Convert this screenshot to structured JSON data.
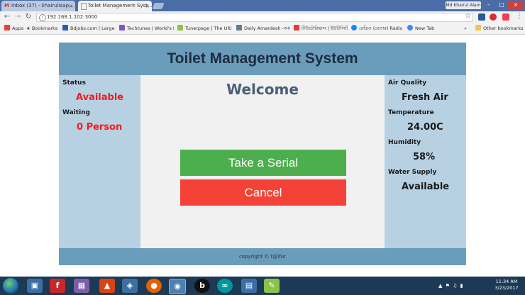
{
  "browser": {
    "tabs": [
      {
        "label": "Inbox (37) - khairulisap…",
        "active": false,
        "favicon": "M"
      },
      {
        "label": "Toilet Management Syst…",
        "active": true,
        "favicon": ""
      }
    ],
    "tab_close": "×",
    "user_label": "Md Khairul Alam",
    "window_buttons": {
      "minimize": "–",
      "maximize": "□",
      "close": "×"
    },
    "url": "192.168.1.102:3000",
    "bookmarks": [
      {
        "label": "Apps",
        "color": "#e94235"
      },
      {
        "label": "Bookmarks",
        "color": "#555555"
      },
      {
        "label": "Bdjobs.com | Largest",
        "color": "#2a5db0"
      },
      {
        "label": "Techtunes | World's F",
        "color": "#7e57c2"
      },
      {
        "label": "Tunerpage | The Ultim",
        "color": "#8bc34a"
      },
      {
        "label": "Daily Amardesh -আমার",
        "color": "#607d8b"
      },
      {
        "label": "টিউটোরিয়াল | ইউটিলিটি সফট",
        "color": "#e53935"
      },
      {
        "label": "রেডিও (বেতার) Radio",
        "color": "#1e88e5"
      },
      {
        "label": "New Tab",
        "color": "#4285f4"
      }
    ],
    "more_bookmarks": "»",
    "other_bookmarks": "Other bookmarks"
  },
  "page": {
    "title": "Toilet Management System",
    "left": {
      "status_label": "Status",
      "status_value": "Available",
      "waiting_label": "Waiting",
      "waiting_value": "0 Person"
    },
    "main": {
      "welcome": "Welcome",
      "serial_button": "Take a Serial",
      "cancel_button": "Cancel"
    },
    "right": {
      "air_quality_label": "Air Quality",
      "air_quality_value": "Fresh Air",
      "temperature_label": "Temperature",
      "temperature_value": "24.00C",
      "humidity_label": "Humidity",
      "humidity_value": "58%",
      "water_label": "Water Supply",
      "water_value": "Available"
    },
    "footer": "copyright © t@ifur"
  },
  "taskbar": {
    "clock_time": "11:34 AM",
    "clock_date": "3/23/2017"
  },
  "colors": {
    "header": "#6a9cbc",
    "sidebar": "#b7d1e2",
    "main": "#f1f1f1",
    "green_button": "#4cae4c",
    "red_button": "#f44336",
    "red_text": "#f21c1c"
  }
}
